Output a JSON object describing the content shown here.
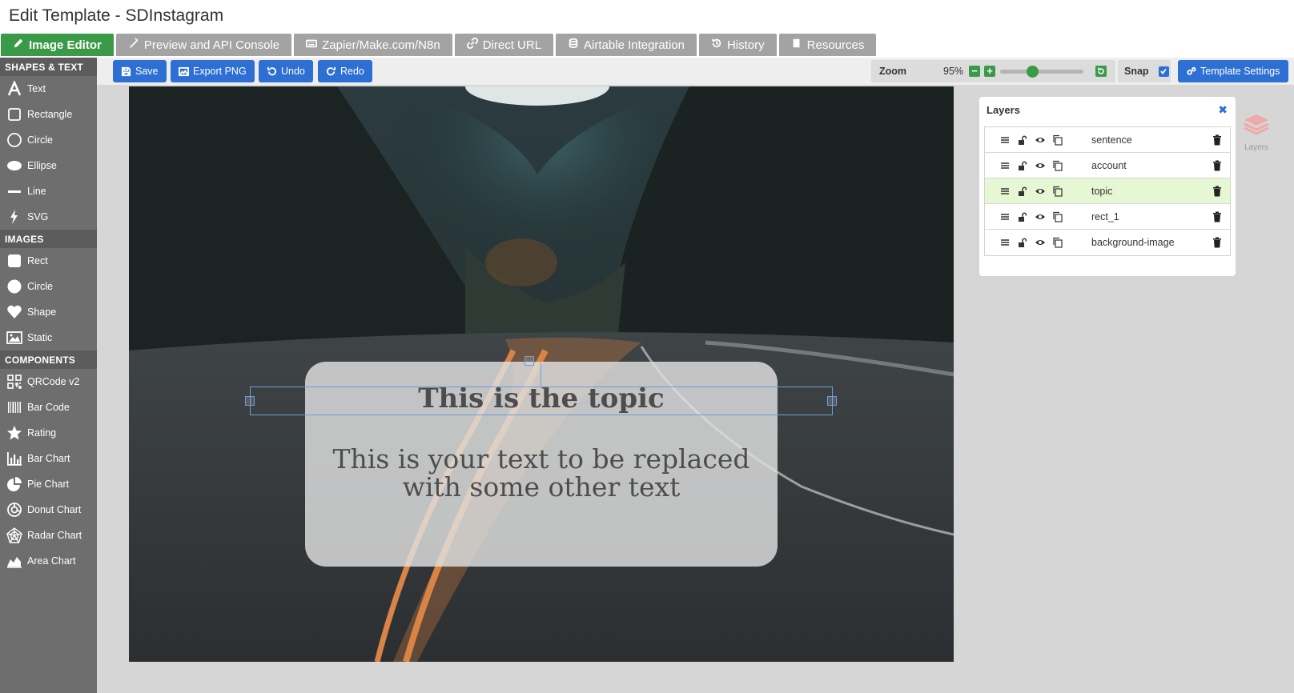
{
  "app": {
    "title": "Edit Template - SDInstagram"
  },
  "tabs": [
    {
      "label": "Image Editor",
      "icon": "pencil-icon",
      "active": true
    },
    {
      "label": "Preview and API Console",
      "icon": "magic-wand-icon",
      "active": false
    },
    {
      "label": "Zapier/Make.com/N8n",
      "icon": "keyboard-icon",
      "active": false
    },
    {
      "label": "Direct URL",
      "icon": "link-icon",
      "active": false
    },
    {
      "label": "Airtable Integration",
      "icon": "database-icon",
      "active": false
    },
    {
      "label": "History",
      "icon": "history-icon",
      "active": false
    },
    {
      "label": "Resources",
      "icon": "book-icon",
      "active": false
    }
  ],
  "sidebar": {
    "sections": [
      {
        "title": "SHAPES & TEXT",
        "items": [
          {
            "label": "Text",
            "icon": "text-icon"
          },
          {
            "label": "Rectangle",
            "icon": "rectangle-icon"
          },
          {
            "label": "Circle",
            "icon": "circle-outline-icon"
          },
          {
            "label": "Ellipse",
            "icon": "ellipse-icon"
          },
          {
            "label": "Line",
            "icon": "line-icon"
          },
          {
            "label": "SVG",
            "icon": "bolt-icon"
          }
        ]
      },
      {
        "title": "IMAGES",
        "items": [
          {
            "label": "Rect",
            "icon": "rect-image-icon"
          },
          {
            "label": "Circle",
            "icon": "circle-image-icon"
          },
          {
            "label": "Shape",
            "icon": "heart-icon"
          },
          {
            "label": "Static",
            "icon": "picture-icon"
          }
        ]
      },
      {
        "title": "COMPONENTS",
        "items": [
          {
            "label": "QRCode v2",
            "icon": "qrcode-icon"
          },
          {
            "label": "Bar Code",
            "icon": "barcode-icon"
          },
          {
            "label": "Rating",
            "icon": "star-icon"
          },
          {
            "label": "Bar Chart",
            "icon": "bar-chart-icon"
          },
          {
            "label": "Pie Chart",
            "icon": "pie-chart-icon"
          },
          {
            "label": "Donut Chart",
            "icon": "donut-chart-icon"
          },
          {
            "label": "Radar Chart",
            "icon": "radar-chart-icon"
          },
          {
            "label": "Area Chart",
            "icon": "area-chart-icon"
          }
        ]
      }
    ]
  },
  "toolbar": {
    "save": "Save",
    "export": "Export PNG",
    "undo": "Undo",
    "redo": "Redo",
    "zoom_label": "Zoom",
    "zoom_value": "95%",
    "zoom_level": 0.38,
    "snap_label": "Snap",
    "snap_checked": true,
    "template_settings": "Template Settings"
  },
  "canvas": {
    "topic": "This is the topic",
    "sentence_line1": "This is your text to be replaced",
    "sentence_line2": "with some other text"
  },
  "layers": {
    "title": "Layers",
    "toggle_label": "Layers",
    "items": [
      {
        "name": "sentence",
        "active": false
      },
      {
        "name": "account",
        "active": false
      },
      {
        "name": "topic",
        "active": true
      },
      {
        "name": "rect_1",
        "active": false
      },
      {
        "name": "background-image",
        "active": false
      }
    ]
  },
  "colors": {
    "accent_green": "#3a9a48",
    "button_blue": "#2e6fd3",
    "tab_gray": "#a3a3a3",
    "sidebar_gray": "#6e6e6e",
    "active_layer": "#e6f7d4"
  }
}
